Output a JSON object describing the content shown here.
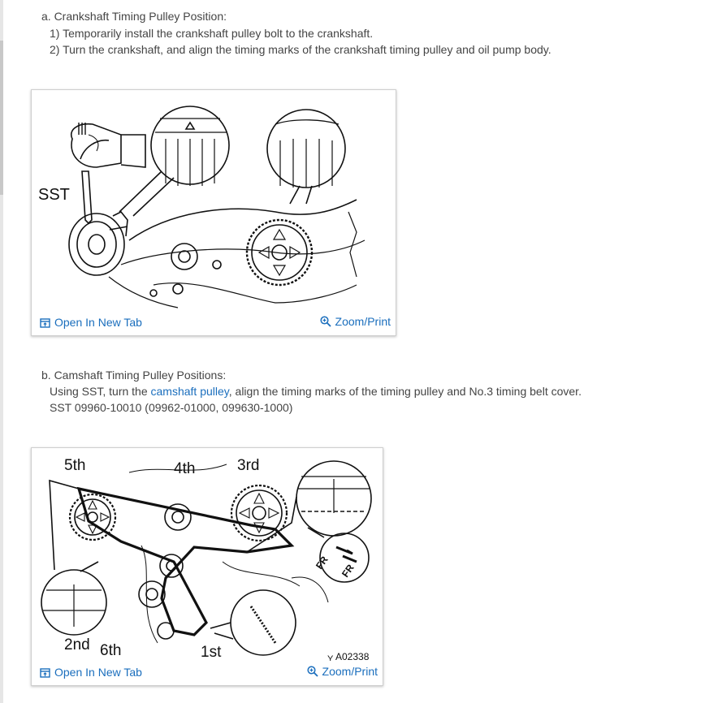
{
  "section_a": {
    "heading": "a. Crankshaft Timing Pulley Position:",
    "steps": [
      "1) Temporarily install the crankshaft pulley bolt to the crankshaft.",
      "2) Turn the crankshaft, and align the timing marks of the crankshaft timing pulley and oil pump body."
    ],
    "figure": {
      "label_sst": "SST",
      "open_label": "Open In New Tab",
      "zoom_label": "Zoom/Print"
    }
  },
  "section_b": {
    "heading": "b. Camshaft Timing Pulley Positions:",
    "line1_before": "Using SST, turn the ",
    "line1_link": "camshaft pulley",
    "line1_after": ", align the timing marks of the timing pulley and No.3 timing belt cover.",
    "line2": "SST 09960-10010 (09962-01000, 099630-1000)",
    "figure": {
      "labels": {
        "fifth": "5th",
        "fourth": "4th",
        "third": "3rd",
        "second": "2nd",
        "sixth": "6th",
        "first": "1st",
        "fr1": "FR",
        "fr2": "FR",
        "code_prefix": "Y",
        "code": "A02338"
      },
      "open_label": "Open In New Tab",
      "zoom_label": "Zoom/Print"
    }
  },
  "colors": {
    "link": "#1a6ebd",
    "text": "#444444"
  },
  "icons": {
    "open": "open-new-tab-icon",
    "zoom": "zoom-icon"
  }
}
